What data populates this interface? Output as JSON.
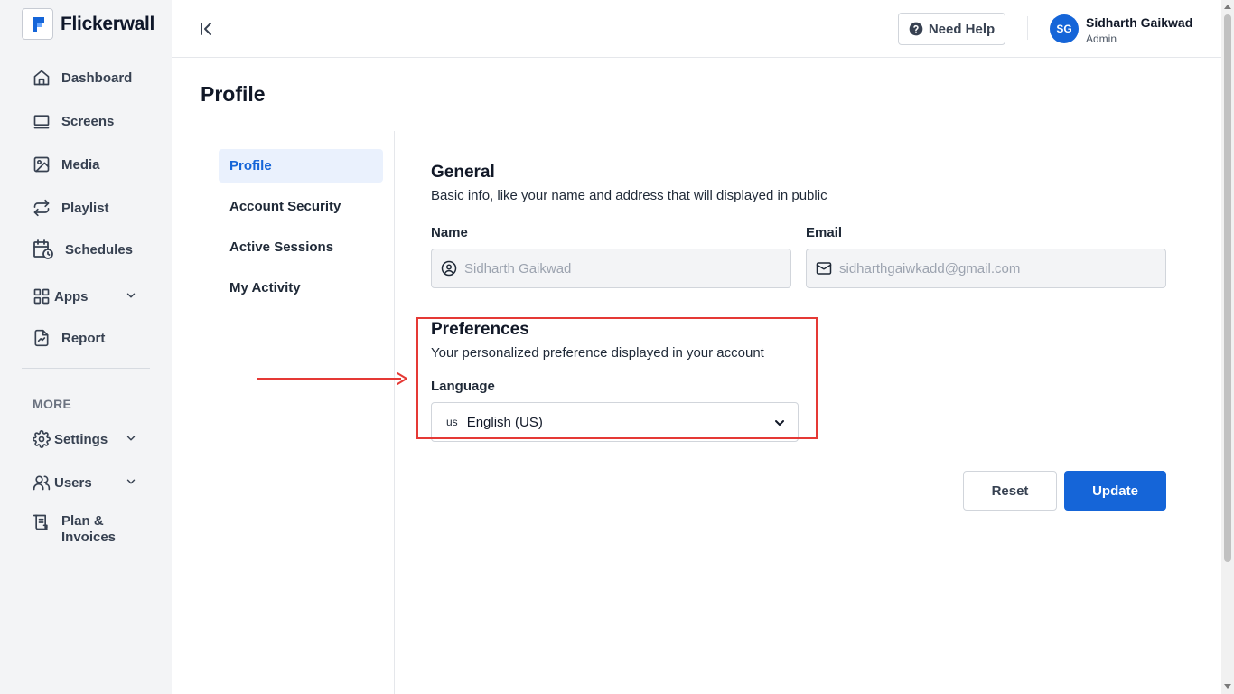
{
  "app": {
    "name": "Flickerwall"
  },
  "sidebar": {
    "items": [
      {
        "label": "Dashboard",
        "icon": "home-icon"
      },
      {
        "label": "Screens",
        "icon": "screen-icon"
      },
      {
        "label": "Media",
        "icon": "image-icon"
      },
      {
        "label": "Playlist",
        "icon": "repeat-icon"
      },
      {
        "label": "Schedules",
        "icon": "calendar-clock-icon"
      },
      {
        "label": "Apps",
        "icon": "grid-icon",
        "expandable": true
      },
      {
        "label": "Report",
        "icon": "report-icon"
      }
    ],
    "more_label": "MORE",
    "more_items": [
      {
        "label": "Settings",
        "icon": "gear-icon",
        "expandable": true
      },
      {
        "label": "Users",
        "icon": "users-icon",
        "expandable": true
      },
      {
        "label": "Plan &",
        "label2": "Invoices",
        "icon": "invoice-icon"
      }
    ]
  },
  "header": {
    "help_label": "Need Help",
    "user": {
      "initials": "SG",
      "name": "Sidharth Gaikwad",
      "role": "Admin"
    }
  },
  "page": {
    "title": "Profile",
    "subnav": [
      {
        "label": "Profile",
        "active": true
      },
      {
        "label": "Account Security"
      },
      {
        "label": "Active Sessions"
      },
      {
        "label": "My Activity"
      }
    ],
    "general": {
      "title": "General",
      "description": "Basic info, like your name and address that will displayed in public",
      "name_label": "Name",
      "name_value": "Sidharth Gaikwad",
      "email_label": "Email",
      "email_value": "sidharthgaiwkadd@gmail.com"
    },
    "preferences": {
      "title": "Preferences",
      "description": "Your personalized preference displayed in your account",
      "language_label": "Language",
      "language_flag": "us",
      "language_value": "English (US)"
    },
    "actions": {
      "reset_label": "Reset",
      "update_label": "Update"
    }
  },
  "colors": {
    "primary": "#1565d8",
    "annotation": "#e53935",
    "sidebar_bg": "#f3f4f6"
  }
}
